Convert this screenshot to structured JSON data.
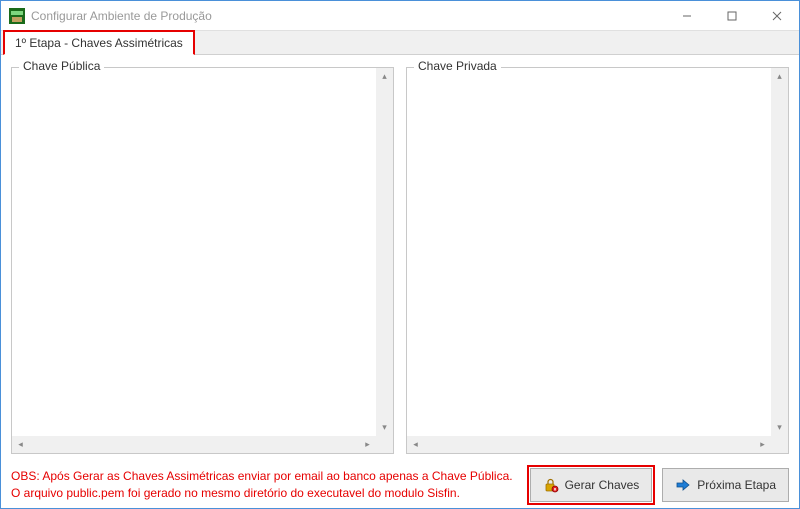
{
  "titlebar": {
    "title": "Configurar Ambiente de Produção"
  },
  "tab": {
    "label": "1º Etapa -  Chaves Assimétricas"
  },
  "panels": {
    "public": {
      "label": "Chave Pública",
      "value": ""
    },
    "private": {
      "label": "Chave Privada",
      "value": ""
    }
  },
  "obs": {
    "line1": "OBS: Após Gerar as Chaves Assimétricas enviar por email ao banco apenas a Chave Pública.",
    "line2": "O arquivo public.pem foi gerado no mesmo diretório do executavel do modulo Sisfin."
  },
  "buttons": {
    "generate": "Gerar Chaves",
    "next": "Próxima Etapa"
  }
}
